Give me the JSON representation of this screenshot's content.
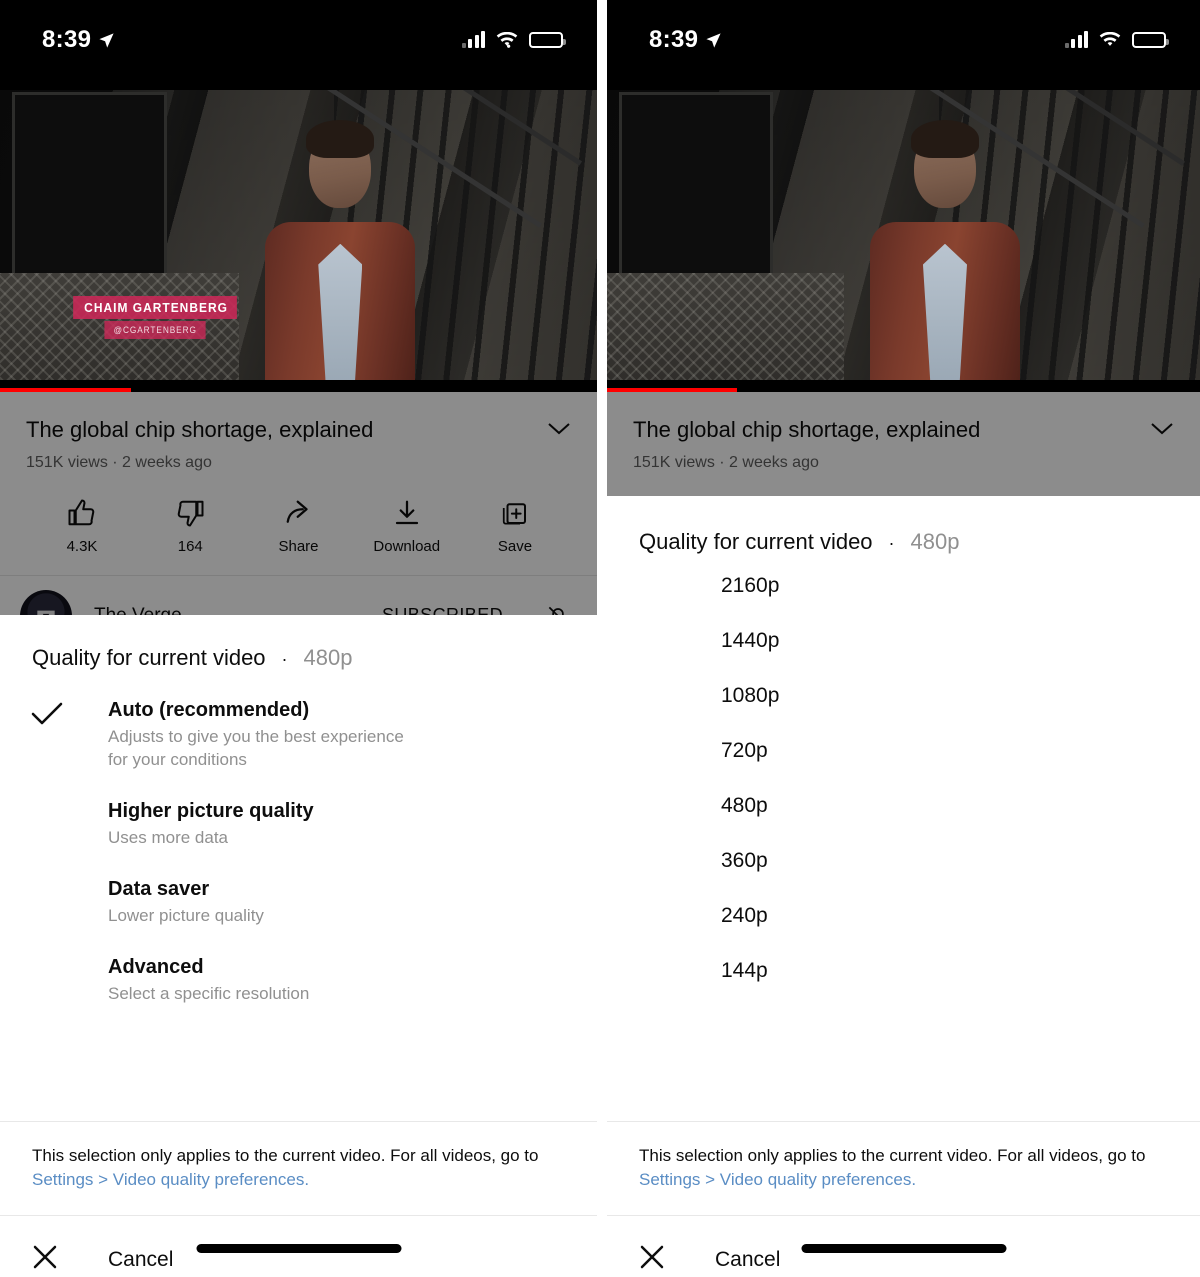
{
  "status_bar": {
    "time": "8:39",
    "location_icon": "location-arrow-icon",
    "signal_icon": "cellular-signal-icon",
    "wifi_icon": "wifi-icon",
    "battery_icon": "battery-full-icon"
  },
  "video": {
    "chyron_name": "CHAIM GARTENBERG",
    "chyron_handle": "@CGARTENBERG",
    "progress_percent": 22,
    "progress_color": "#ff0000"
  },
  "video_info": {
    "title": "The global chip shortage, explained",
    "meta": "151K views · 2 weeks ago",
    "expand_icon": "chevron-down-icon",
    "actions": [
      {
        "icon": "thumbs-up-icon",
        "label": "4.3K"
      },
      {
        "icon": "thumbs-down-icon",
        "label": "164"
      },
      {
        "icon": "share-icon",
        "label": "Share"
      },
      {
        "icon": "download-icon",
        "label": "Download"
      },
      {
        "icon": "save-to-playlist-icon",
        "label": "Save"
      }
    ],
    "channel": {
      "name": "The Verge",
      "subscribe_label": "SUBSCRIBED",
      "bell_icon": "bell-off-icon"
    }
  },
  "sheet": {
    "header_title": "Quality for current video",
    "header_separator": "·",
    "header_value": "480p",
    "options": [
      {
        "title": "Auto (recommended)",
        "subtitle": "Adjusts to give you the best experience for your conditions",
        "selected": true
      },
      {
        "title": "Higher picture quality",
        "subtitle": "Uses more data",
        "selected": false
      },
      {
        "title": "Data saver",
        "subtitle": "Lower picture quality",
        "selected": false
      },
      {
        "title": "Advanced",
        "subtitle": "Select a specific resolution",
        "selected": false
      }
    ],
    "resolutions": [
      "2160p",
      "1440p",
      "1080p",
      "720p",
      "480p",
      "360p",
      "240p",
      "144p"
    ],
    "note_text": "This selection only applies to the current video. For all videos, go to ",
    "note_link": "Settings > Video quality preferences.",
    "note_link_color": "#5a8dc4",
    "cancel_label": "Cancel",
    "cancel_icon": "close-icon",
    "checkmark_icon": "checkmark-icon"
  }
}
